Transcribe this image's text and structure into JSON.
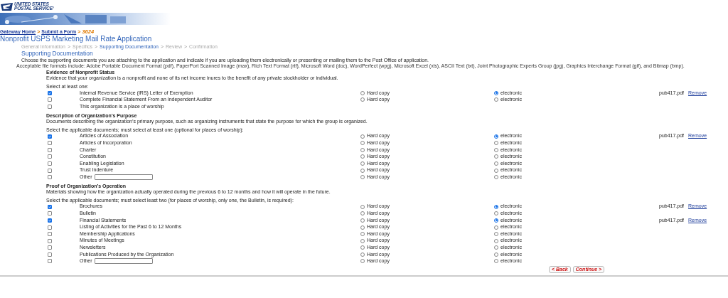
{
  "logo": {
    "lines": [
      "UNITED STATES",
      "POSTAL SERVICE"
    ],
    "mark": "®"
  },
  "banner": {
    "kind": "picture"
  },
  "breadcrumb": {
    "links": [
      "Gateway Home",
      "Submit a Form"
    ],
    "separator": ">",
    "current": "3624"
  },
  "title": "Nonprofit USPS Marketing Mail Rate Application",
  "steps": [
    {
      "label": "General Information",
      "selected": false
    },
    {
      "label": "Specifics",
      "selected": false
    },
    {
      "label": "Supporting Documentation",
      "selected": true
    },
    {
      "label": "Review",
      "selected": false
    },
    {
      "label": "Confirmation",
      "selected": false
    }
  ],
  "step_separator": ">",
  "section_title": "Supporting Documentation",
  "instructions": "Choose the supporting documents you are attaching to the application and indicate if you are uploading them electronically or presenting or mailing them to the Post Office of application.",
  "formats_note": "Acceptable file formats include: Adobe Portable Document Format (pdf), PaperPort Scanned Image (max), Rich Text Format (rtf), Microsoft Word (doc), WordPerfect (wpg), Microsoft Excel (xls), ASCII Text (txt), Joint Photographic Experts Group (jpg), Graphics Interchange Format (gif), and Bitmap (bmp).",
  "groups": [
    {
      "heading": "Evidence of Nonprofit Status",
      "description": "Evidence that your organization is a nonprofit and none of its net income inures to the benefit of any private stockholder or individual.",
      "prompt": "Select at least one:",
      "rows": [
        {
          "kind": "document",
          "label": "Internal Revenue Service (IRS) Letter of Exemption",
          "checked": true,
          "options": [
            {
              "label": "Hard copy",
              "selected": false
            },
            {
              "label": "electronic",
              "selected": true
            }
          ],
          "file": "pub417.pdf",
          "remove": "Remove"
        },
        {
          "kind": "document",
          "label": "Complete Financial Statement From an Independent Auditor",
          "checked": false,
          "options": [
            {
              "label": "Hard copy",
              "selected": false
            },
            {
              "label": "electronic",
              "selected": false
            }
          ]
        },
        {
          "kind": "worship",
          "label": "This organization is a place of worship",
          "checked": false
        }
      ]
    },
    {
      "heading": "Description of Organization’s Purpose",
      "description": "Documents describing the organization’s primary purpose, such as organizing instruments that state the purpose for which the group is organized.",
      "prompt": "Select the applicable documents; must select at least one (optional for places of worship):",
      "rows": [
        {
          "kind": "document",
          "label": "Articles of Association",
          "checked": true,
          "options": [
            {
              "label": "Hard copy",
              "selected": false
            },
            {
              "label": "electronic",
              "selected": true
            }
          ],
          "file": "pub417.pdf",
          "remove": "Remove"
        },
        {
          "kind": "document",
          "label": "Articles of Incorporation",
          "checked": false,
          "options": [
            {
              "label": "Hard copy",
              "selected": false
            },
            {
              "label": "electronic",
              "selected": false
            }
          ]
        },
        {
          "kind": "document",
          "label": "Charter",
          "checked": false,
          "options": [
            {
              "label": "Hard copy",
              "selected": false
            },
            {
              "label": "electronic",
              "selected": false
            }
          ]
        },
        {
          "kind": "document",
          "label": "Constitution",
          "checked": false,
          "options": [
            {
              "label": "Hard copy",
              "selected": false
            },
            {
              "label": "electronic",
              "selected": false
            }
          ]
        },
        {
          "kind": "document",
          "label": "Enabling Legislation",
          "checked": false,
          "options": [
            {
              "label": "Hard copy",
              "selected": false
            },
            {
              "label": "electronic",
              "selected": false
            }
          ]
        },
        {
          "kind": "document",
          "label": "Trust Indenture",
          "checked": false,
          "options": [
            {
              "label": "Hard copy",
              "selected": false
            },
            {
              "label": "electronic",
              "selected": false
            }
          ]
        },
        {
          "kind": "other",
          "label": "Other",
          "checked": false,
          "options": [
            {
              "label": "Hard copy",
              "selected": false
            },
            {
              "label": "electronic",
              "selected": false
            }
          ]
        }
      ]
    },
    {
      "heading": "Proof of Organization’s Operation",
      "description": "Materials showing how the organization actually operated during the previous 6 to 12 months and how it will operate in the future.",
      "prompt": "Select the applicable documents; must select least two (for places of worship, only one, the Bulletin, is required):",
      "rows": [
        {
          "kind": "document",
          "label": "Brochures",
          "checked": true,
          "options": [
            {
              "label": "Hard copy",
              "selected": false
            },
            {
              "label": "electronic",
              "selected": true
            }
          ],
          "file": "pub417.pdf",
          "remove": "Remove"
        },
        {
          "kind": "document",
          "label": "Bulletin",
          "checked": false,
          "options": [
            {
              "label": "Hard copy",
              "selected": false
            },
            {
              "label": "electronic",
              "selected": false
            }
          ]
        },
        {
          "kind": "document",
          "label": "Financial Statements",
          "checked": true,
          "options": [
            {
              "label": "Hard copy",
              "selected": false
            },
            {
              "label": "electronic",
              "selected": true
            }
          ],
          "file": "pub417.pdf",
          "remove": "Remove"
        },
        {
          "kind": "document",
          "label": "Listing of Activities for the Past 6 to 12 Months",
          "checked": false,
          "options": [
            {
              "label": "Hard copy",
              "selected": false
            },
            {
              "label": "electronic",
              "selected": false
            }
          ]
        },
        {
          "kind": "document",
          "label": "Membership Applications",
          "checked": false,
          "options": [
            {
              "label": "Hard copy",
              "selected": false
            },
            {
              "label": "electronic",
              "selected": false
            }
          ]
        },
        {
          "kind": "document",
          "label": "Minutes of Meetings",
          "checked": false,
          "options": [
            {
              "label": "Hard copy",
              "selected": false
            },
            {
              "label": "electronic",
              "selected": false
            }
          ]
        },
        {
          "kind": "document",
          "label": "Newsletters",
          "checked": false,
          "options": [
            {
              "label": "Hard copy",
              "selected": false
            },
            {
              "label": "electronic",
              "selected": false
            }
          ]
        },
        {
          "kind": "document",
          "label": "Publications Produced by the Organization",
          "checked": false,
          "options": [
            {
              "label": "Hard copy",
              "selected": false
            },
            {
              "label": "electronic",
              "selected": false
            }
          ]
        },
        {
          "kind": "other",
          "label": "Other",
          "checked": false,
          "options": [
            {
              "label": "Hard copy",
              "selected": false
            },
            {
              "label": "electronic",
              "selected": false
            }
          ]
        }
      ]
    }
  ],
  "buttons": [
    "< Back",
    "Continue >"
  ]
}
